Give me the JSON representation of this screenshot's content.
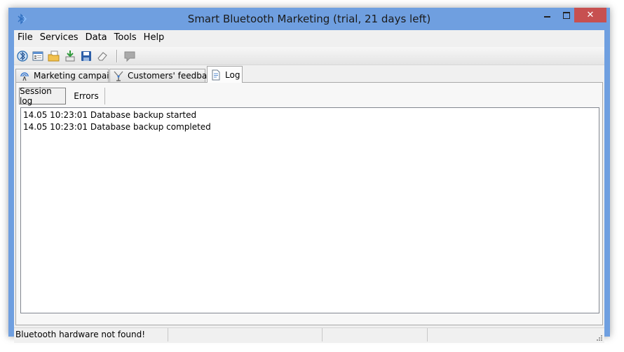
{
  "window": {
    "title": "Smart Bluetooth Marketing (trial, 21 days left)",
    "app_icon": "bluetooth-app-icon",
    "controls": {
      "minimize": "minimize-icon",
      "maximize": "maximize-icon",
      "close": "close-icon"
    }
  },
  "menu": {
    "items": [
      {
        "label": "File"
      },
      {
        "label": "Services"
      },
      {
        "label": "Data"
      },
      {
        "label": "Tools"
      },
      {
        "label": "Help"
      }
    ]
  },
  "toolbar": {
    "buttons": [
      "scan-devices-icon",
      "properties-icon",
      "open-folder-icon",
      "import-icon",
      "save-icon",
      "eraser-icon"
    ],
    "disabled": [
      "message-icon"
    ]
  },
  "tabs": [
    {
      "label": "Marketing campaigns",
      "icon": "broadcast-icon"
    },
    {
      "label": "Customers' feedback",
      "icon": "antenna-icon"
    },
    {
      "label": "Log",
      "icon": "log-document-icon",
      "active": true
    }
  ],
  "log": {
    "subtabs": [
      {
        "label": "Session log",
        "active": true
      },
      {
        "label": "Errors"
      }
    ],
    "entries": [
      "14.05 10:23:01 Database backup started",
      "14.05 10:23:01 Database backup completed"
    ]
  },
  "status": {
    "message": "Bluetooth hardware not found!",
    "cells": [
      "",
      "",
      ""
    ]
  },
  "colors": {
    "title_bar": "#6f9fe0",
    "close_button": "#c75050",
    "client_bg": "#f0f0f0"
  }
}
